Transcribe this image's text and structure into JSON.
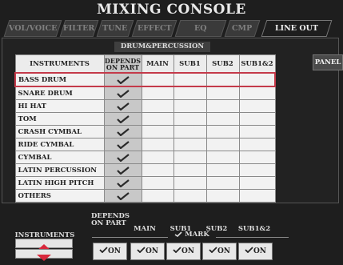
{
  "title": "MIXING CONSOLE",
  "tabs": [
    {
      "label": "VOL/VOICE",
      "active": false
    },
    {
      "label": "FILTER",
      "active": false
    },
    {
      "label": "TUNE",
      "active": false
    },
    {
      "label": "EFFECT",
      "active": false
    },
    {
      "label": "EQ",
      "active": false
    },
    {
      "label": "CMP",
      "active": false
    },
    {
      "label": "LINE OUT",
      "active": true
    }
  ],
  "section_label": "DRUM&PERCUSSION",
  "panel_button": "PANEL",
  "columns": [
    "INSTRUMENTS",
    "DEPENDS ON PART",
    "MAIN",
    "SUB1",
    "SUB2",
    "SUB1&2"
  ],
  "rows": [
    {
      "name": "BASS DRUM",
      "selected": true,
      "depends_on_part": true
    },
    {
      "name": "SNARE DRUM",
      "selected": false,
      "depends_on_part": true
    },
    {
      "name": "HI HAT",
      "selected": false,
      "depends_on_part": true
    },
    {
      "name": "TOM",
      "selected": false,
      "depends_on_part": true
    },
    {
      "name": "CRASH CYMBAL",
      "selected": false,
      "depends_on_part": true
    },
    {
      "name": "RIDE CYMBAL",
      "selected": false,
      "depends_on_part": true
    },
    {
      "name": "CYMBAL",
      "selected": false,
      "depends_on_part": true
    },
    {
      "name": "LATIN PERCUSSION",
      "selected": false,
      "depends_on_part": true
    },
    {
      "name": "LATIN HIGH PITCH",
      "selected": false,
      "depends_on_part": true
    },
    {
      "name": "OTHERS",
      "selected": false,
      "depends_on_part": true
    }
  ],
  "bottom": {
    "instruments_label": "INSTRUMENTS",
    "depends_label_1": "DEPENDS",
    "depends_label_2": "ON PART",
    "main_label": "MAIN",
    "sub1_label": "SUB1",
    "sub2_label": "SUB2",
    "sub12_label": "SUB1&2",
    "mark_label": "MARK",
    "on_buttons": [
      "ON",
      "ON",
      "ON",
      "ON",
      "ON"
    ]
  },
  "colors": {
    "selection": "#c43a4a",
    "check": "#2a2a2a"
  }
}
